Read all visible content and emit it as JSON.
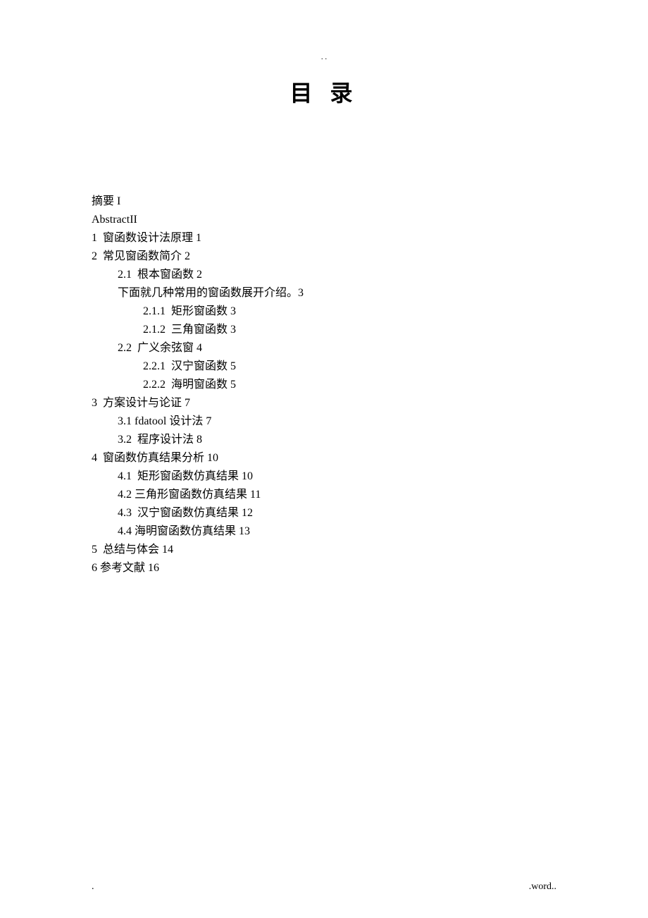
{
  "header_dots": ".\n.",
  "title": "目 录",
  "toc": [
    {
      "indent": 0,
      "text": "摘要 I"
    },
    {
      "indent": 0,
      "text": "AbstractII"
    },
    {
      "indent": 0,
      "text": "1  窗函数设计法原理 1"
    },
    {
      "indent": 0,
      "text": "2  常见窗函数简介 2"
    },
    {
      "indent": 1,
      "text": "2.1  根本窗函数 2"
    },
    {
      "indent": 1,
      "text": "下面就几种常用的窗函数展开介绍。3"
    },
    {
      "indent": 2,
      "text": "2.1.1  矩形窗函数 3"
    },
    {
      "indent": 2,
      "text": "2.1.2  三角窗函数 3"
    },
    {
      "indent": 1,
      "text": "2.2  广义余弦窗 4"
    },
    {
      "indent": 2,
      "text": "2.2.1  汉宁窗函数 5"
    },
    {
      "indent": 2,
      "text": "2.2.2  海明窗函数 5"
    },
    {
      "indent": 0,
      "text": "3  方案设计与论证 7"
    },
    {
      "indent": 1,
      "text": "3.1 fdatool 设计法 7"
    },
    {
      "indent": 1,
      "text": "3.2  程序设计法 8"
    },
    {
      "indent": 0,
      "text": "4  窗函数仿真结果分析 10"
    },
    {
      "indent": 1,
      "text": "4.1  矩形窗函数仿真结果 10"
    },
    {
      "indent": 1,
      "text": "4.2 三角形窗函数仿真结果 11"
    },
    {
      "indent": 1,
      "text": "4.3  汉宁窗函数仿真结果 12"
    },
    {
      "indent": 1,
      "text": "4.4 海明窗函数仿真结果 13"
    },
    {
      "indent": 0,
      "text": "5  总结与体会 14"
    },
    {
      "indent": 0,
      "text": "6 参考文献 16"
    }
  ],
  "footer": {
    "left": ".",
    "right": ".word.."
  }
}
